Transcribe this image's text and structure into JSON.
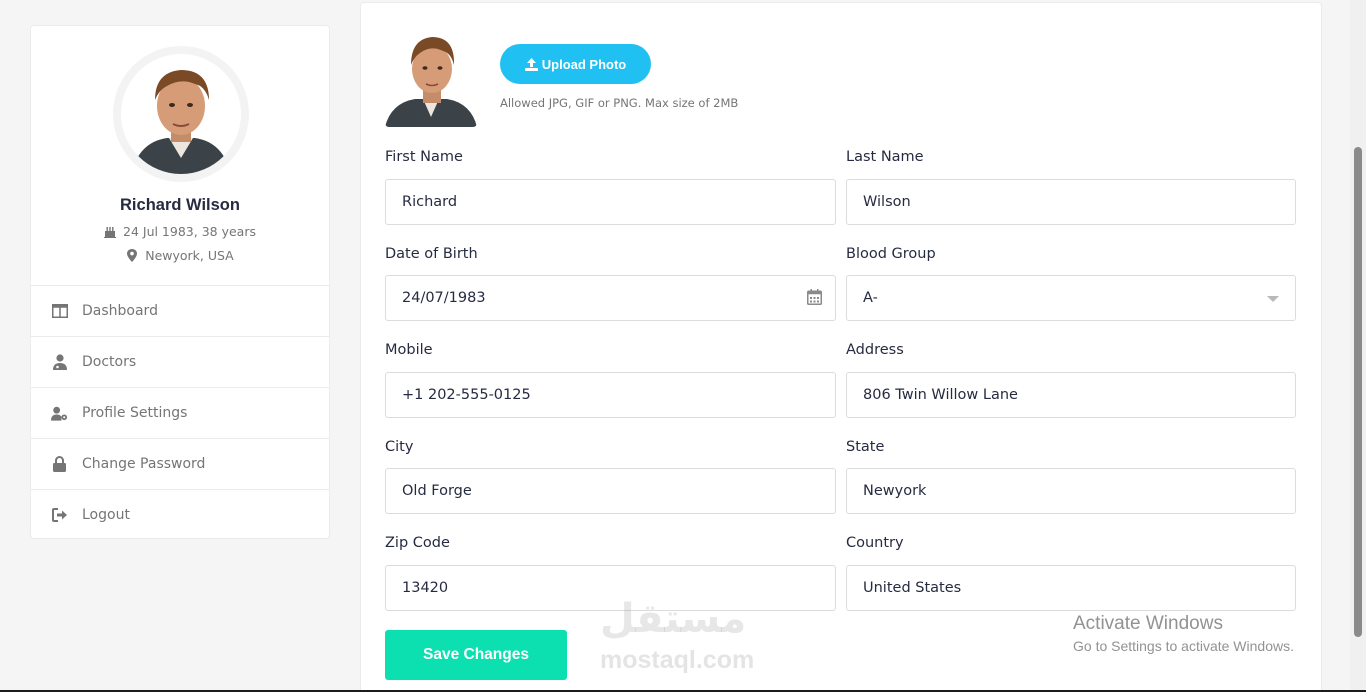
{
  "profile": {
    "name": "Richard Wilson",
    "dob": "24 Jul 1983, 38 years",
    "location": "Newyork, USA"
  },
  "nav": {
    "items": [
      {
        "label": "Dashboard",
        "icon": "columns-icon"
      },
      {
        "label": "Doctors",
        "icon": "user-md-icon"
      },
      {
        "label": "Profile Settings",
        "icon": "user-cog-icon"
      },
      {
        "label": "Change Password",
        "icon": "lock-icon"
      },
      {
        "label": "Logout",
        "icon": "sign-out-icon"
      }
    ]
  },
  "upload": {
    "button_label": "Upload Photo",
    "hint": "Allowed JPG, GIF or PNG. Max size of 2MB"
  },
  "form": {
    "first_name": {
      "label": "First Name",
      "value": "Richard"
    },
    "last_name": {
      "label": "Last Name",
      "value": "Wilson"
    },
    "dob": {
      "label": "Date of Birth",
      "value": "24/07/1983"
    },
    "blood_group": {
      "label": "Blood Group",
      "value": "A-"
    },
    "mobile": {
      "label": "Mobile",
      "value": "+1 202-555-0125"
    },
    "address": {
      "label": "Address",
      "value": "806 Twin Willow Lane"
    },
    "city": {
      "label": "City",
      "value": "Old Forge"
    },
    "state": {
      "label": "State",
      "value": "Newyork"
    },
    "zip": {
      "label": "Zip Code",
      "value": "13420"
    },
    "country": {
      "label": "Country",
      "value": "United States"
    }
  },
  "save_label": "Save Changes",
  "watermark": {
    "arabic": "مستقل",
    "latin": "mostaql.com"
  },
  "windows_notice": {
    "title": "Activate Windows",
    "subtitle": "Go to Settings to activate Windows."
  },
  "colors": {
    "accent_blue": "#20c0f3",
    "save_green": "#0de0b0",
    "text_dark": "#272b41",
    "text_muted": "#757575"
  }
}
